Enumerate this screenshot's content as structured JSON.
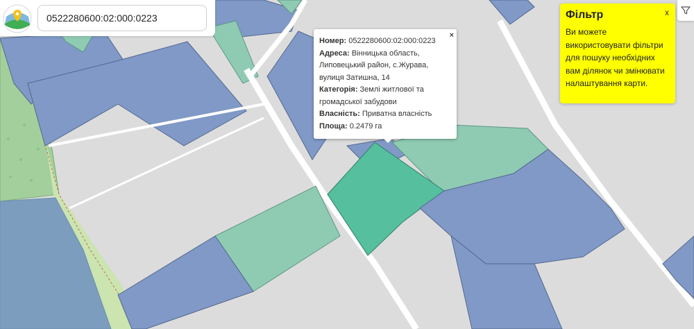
{
  "search": {
    "value": "0522280600:02:000:0223"
  },
  "popup": {
    "close": "×",
    "rows": [
      {
        "label": "Номер:",
        "value": " 0522280600:02:000:0223"
      },
      {
        "label": "Адреса:",
        "value": " Вінницька область, Липовецький район, с.Журава, вулиця Затишна, 14"
      },
      {
        "label": "Категорія:",
        "value": " Землі житлової та громадської забудови"
      },
      {
        "label": "Власність:",
        "value": " Приватна власність"
      },
      {
        "label": "Площа:",
        "value": " 0.2479 га"
      }
    ]
  },
  "filter": {
    "title": "Фільтр",
    "text": "Ви можете використовувати фільтри для пошуку необхідних вам ділянок чи змінювати налаштування карти.",
    "close": "x"
  },
  "colors": {
    "background": "#dcdcdc",
    "private_parcel": "#8099c6",
    "state_parcel": "#8fcbb3",
    "selected_parcel": "#55bf9e",
    "forest": "#a3cf9c",
    "water": "#7c9dbd",
    "road": "#ffffff",
    "filter_panel": "#ffff00"
  },
  "icons": {
    "logo": "map-pin-logo-icon",
    "filter": "filter-funnel-icon",
    "popup_close": "close-icon",
    "filter_close": "close-icon"
  }
}
